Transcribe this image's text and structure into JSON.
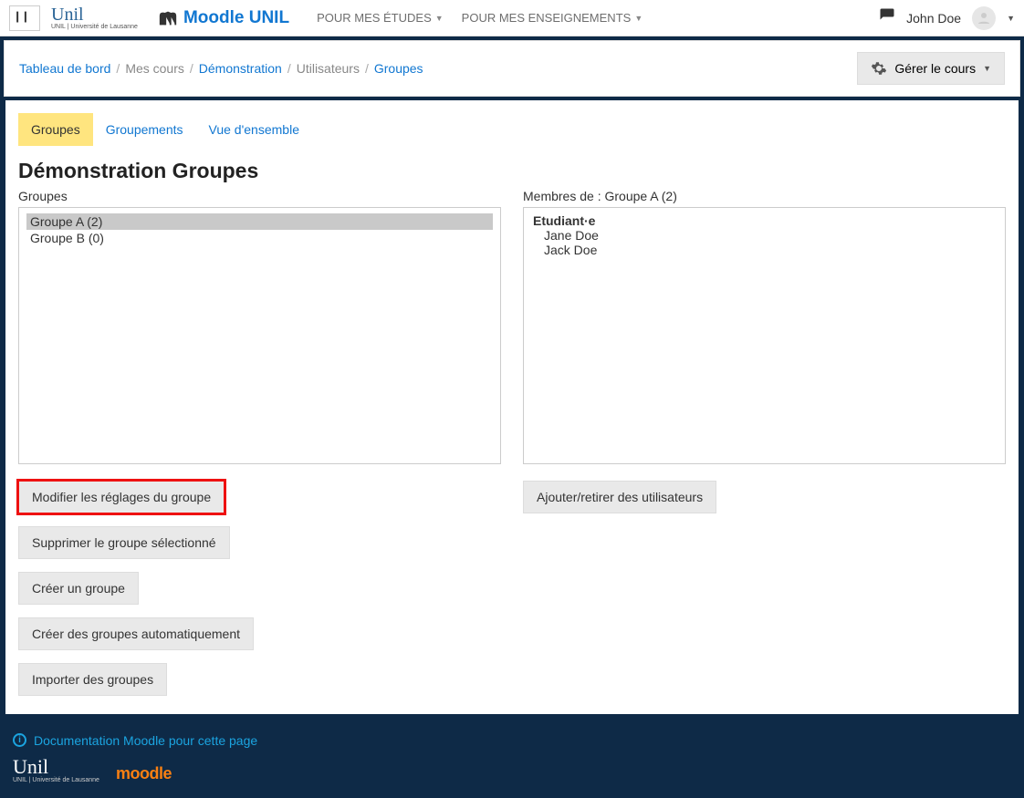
{
  "topbar": {
    "brand": "Moodle UNIL",
    "nav": [
      {
        "label": "POUR MES ÉTUDES"
      },
      {
        "label": "POUR MES ENSEIGNEMENTS"
      }
    ],
    "user": "John Doe"
  },
  "breadcrumb": {
    "items": [
      {
        "label": "Tableau de bord",
        "link": true
      },
      {
        "label": "Mes cours",
        "link": false
      },
      {
        "label": "Démonstration",
        "link": true
      },
      {
        "label": "Utilisateurs",
        "link": false
      },
      {
        "label": "Groupes",
        "link": true
      }
    ],
    "manage_label": "Gérer le cours"
  },
  "tabs": [
    {
      "label": "Groupes",
      "active": true
    },
    {
      "label": "Groupements",
      "active": false
    },
    {
      "label": "Vue d'ensemble",
      "active": false
    }
  ],
  "page_title": "Démonstration Groupes",
  "groups_panel": {
    "label": "Groupes",
    "items": [
      {
        "label": "Groupe A (2)",
        "selected": true
      },
      {
        "label": "Groupe B (0)",
        "selected": false
      }
    ],
    "buttons": {
      "edit": "Modifier les réglages du groupe",
      "delete": "Supprimer le groupe sélectionné",
      "create": "Créer un groupe",
      "auto": "Créer des groupes automatiquement",
      "import": "Importer des groupes"
    }
  },
  "members_panel": {
    "label": "Membres de : Groupe A (2)",
    "role": "Etudiant·e",
    "members": [
      "Jane Doe",
      "Jack Doe"
    ],
    "button": "Ajouter/retirer des utilisateurs"
  },
  "footer": {
    "doc_link": "Documentation Moodle pour cette page"
  }
}
